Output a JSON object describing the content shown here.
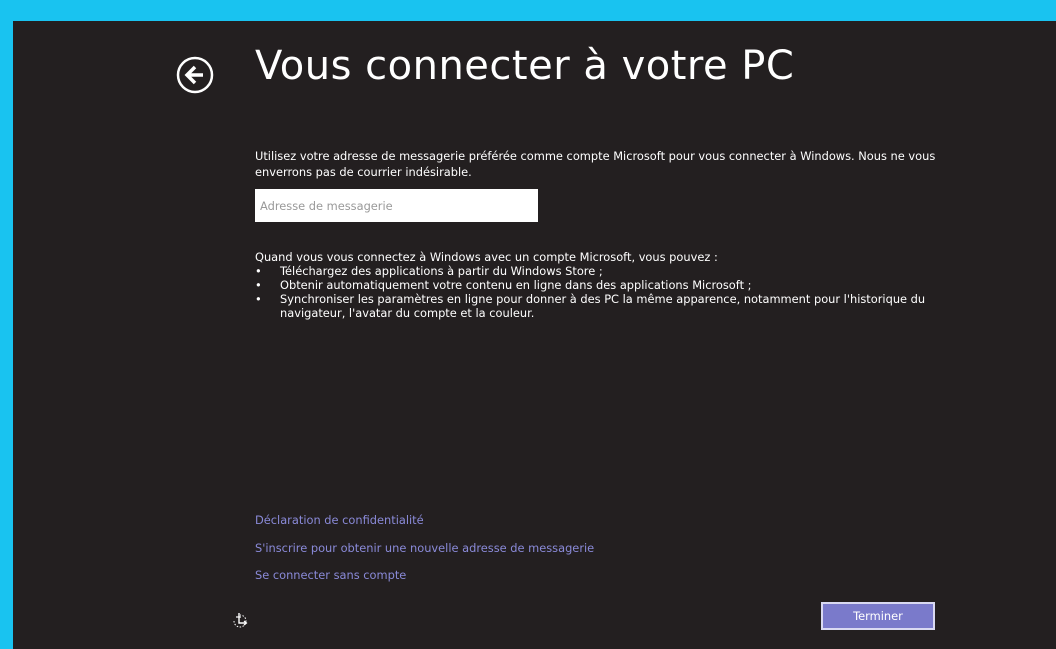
{
  "header": {
    "title": "Vous connecter à votre PC",
    "back_icon": "back-arrow-icon"
  },
  "intro": {
    "text": "Utilisez votre adresse de messagerie préférée comme compte Microsoft pour vous connecter à Windows. Nous ne vous enverrons pas de courrier indésirable."
  },
  "email_field": {
    "value": "",
    "placeholder": "Adresse de messagerie"
  },
  "benefits": {
    "title": "Quand vous vous connectez à Windows avec un compte Microsoft, vous pouvez :",
    "bullet": "•",
    "items": [
      "Téléchargez des applications à partir du Windows Store ;",
      "Obtenir automatiquement votre contenu en ligne dans des applications Microsoft ;",
      "Synchroniser les paramètres en ligne pour donner à des PC la même apparence, notamment pour l'historique du navigateur, l'avatar du compte et la couleur."
    ]
  },
  "links": {
    "privacy": "Déclaration de confidentialité",
    "signup": "S'inscrire pour obtenir une nouvelle adresse de messagerie",
    "no_account": "Se connecter sans compte"
  },
  "footer": {
    "ease_icon": "ease-of-access-icon",
    "finish_label": "Terminer"
  },
  "colors": {
    "background": "#231f20",
    "border_accent": "#19c3f0",
    "link": "#8a8ad8",
    "button": "#7a7acb"
  }
}
